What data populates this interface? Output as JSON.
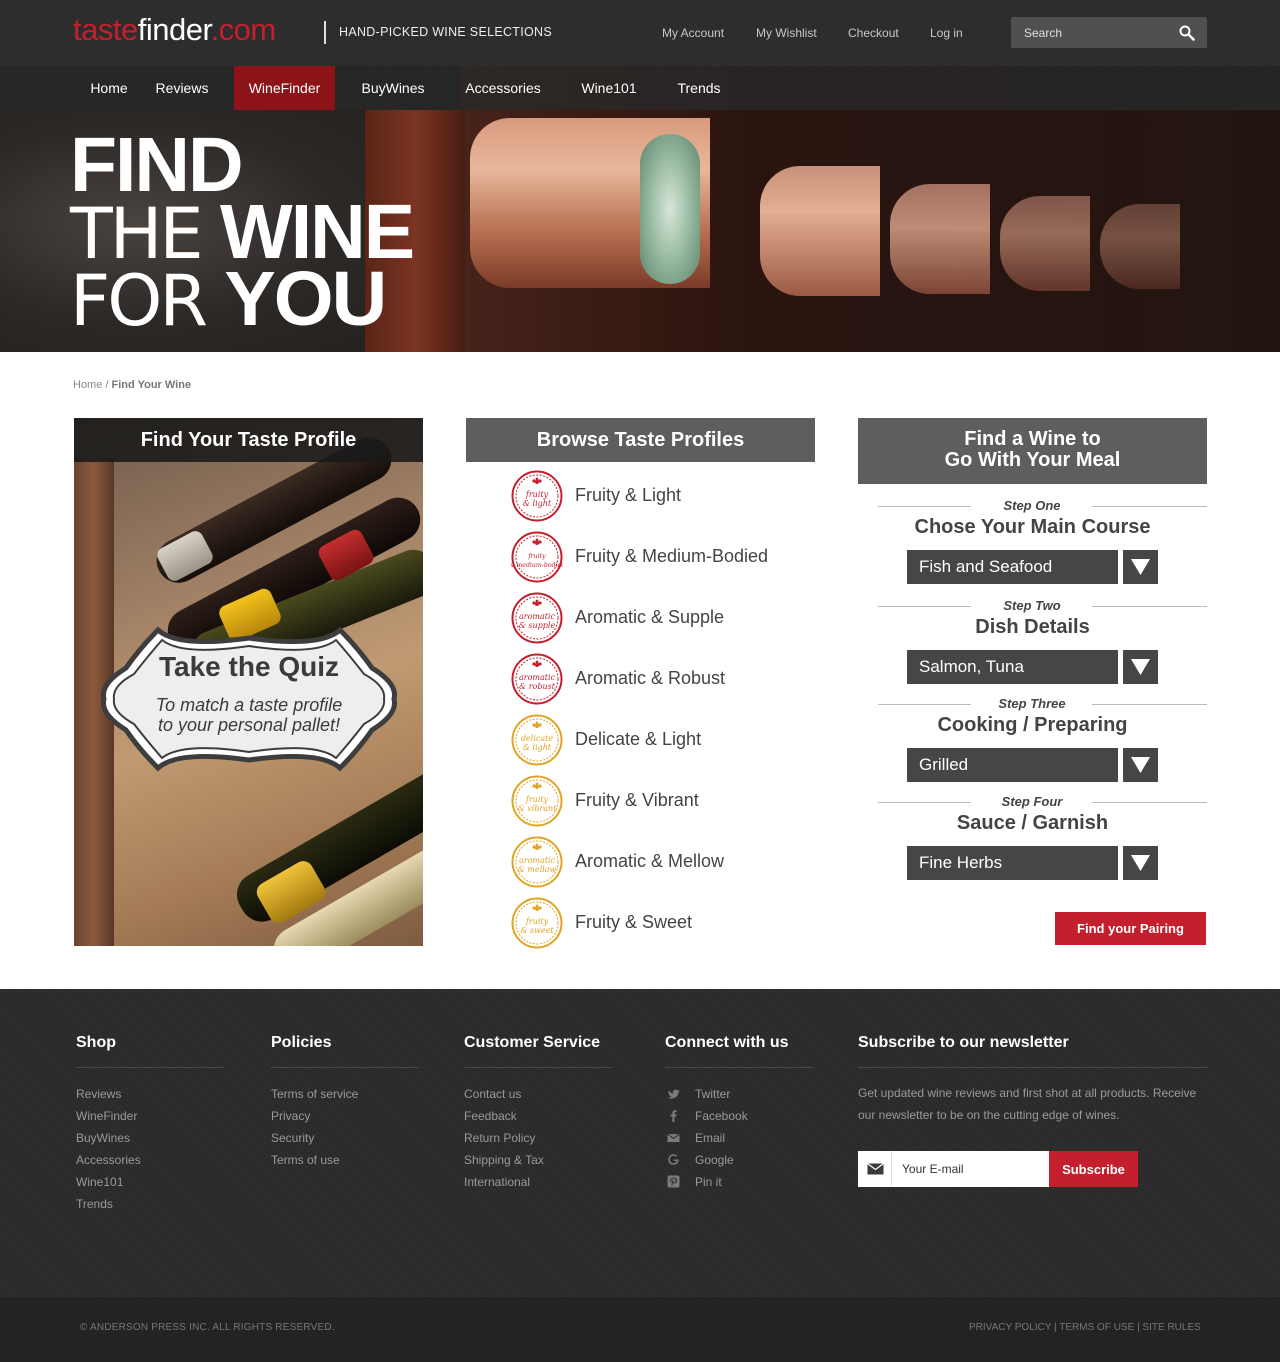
{
  "header": {
    "logo": {
      "part1": "taste",
      "part2": "finder",
      "part3": ".com"
    },
    "tagline": "HAND-PICKED WINE SELECTIONS",
    "links": [
      "My Account",
      "My Wishlist",
      "Checkout",
      "Log in"
    ],
    "search_placeholder": "Search"
  },
  "nav": {
    "items": [
      "Home",
      "Reviews",
      "WineFinder",
      "BuyWines",
      "Accessories",
      "Wine101",
      "Trends"
    ],
    "active": "WineFinder"
  },
  "hero": {
    "line1": "FIND",
    "line2_thin": "THE",
    "line2_bold": "WINE",
    "line3_thin": "FOR",
    "line3_bold": "YOU"
  },
  "breadcrumb": {
    "home": "Home",
    "separator": "/",
    "current": "Find Your Wine"
  },
  "quiz": {
    "heading": "Find Your Taste Profile",
    "title": "Take the Quiz",
    "subtitle_line1": "To match a taste profile",
    "subtitle_line2": "to your personal pallet!"
  },
  "browse": {
    "heading": "Browse Taste Profiles",
    "profiles": [
      {
        "name": "Fruity & Light",
        "seal_text": "fruity & light",
        "color": "#c41f2c"
      },
      {
        "name": "Fruity & Medium-Bodied",
        "seal_text": "fruity & medium-bodied",
        "color": "#c41f2c"
      },
      {
        "name": "Aromatic & Supple",
        "seal_text": "aromatic & supple",
        "color": "#c41f2c"
      },
      {
        "name": "Aromatic & Robust",
        "seal_text": "aromatic & robust",
        "color": "#c41f2c"
      },
      {
        "name": "Delicate & Light",
        "seal_text": "delicate & light",
        "color": "#e0a524"
      },
      {
        "name": "Fruity & Vibrant",
        "seal_text": "fruity & vibrant",
        "color": "#e0a524"
      },
      {
        "name": "Aromatic & Mellow",
        "seal_text": "aromatic & mellow",
        "color": "#e0a524"
      },
      {
        "name": "Fruity & Sweet",
        "seal_text": "fruity & sweet",
        "color": "#e0a524"
      }
    ]
  },
  "meal": {
    "heading_line1": "Find a Wine to",
    "heading_line2": "Go With Your Meal",
    "steps": [
      {
        "label": "Step One",
        "title": "Chose Your Main Course",
        "value": "Fish and Seafood"
      },
      {
        "label": "Step Two",
        "title": "Dish Details",
        "value": "Salmon, Tuna"
      },
      {
        "label": "Step Three",
        "title": "Cooking / Preparing",
        "value": "Grilled"
      },
      {
        "label": "Step Four",
        "title": "Sauce / Garnish",
        "value": "Fine Herbs"
      }
    ],
    "button": "Find your Pairing"
  },
  "footer": {
    "shop": {
      "title": "Shop",
      "links": [
        "Reviews",
        "WineFinder",
        "BuyWines",
        "Accessories",
        "Wine101",
        "Trends"
      ]
    },
    "policies": {
      "title": "Policies",
      "links": [
        "Terms of service",
        "Privacy",
        "Security",
        "Terms of use"
      ]
    },
    "customer_service": {
      "title": "Customer Service",
      "links": [
        "Contact us",
        "Feedback",
        "Return Policy",
        "Shipping & Tax",
        "International"
      ]
    },
    "connect": {
      "title": "Connect with us",
      "links": [
        {
          "label": "Twitter",
          "icon": "twitter-icon"
        },
        {
          "label": "Facebook",
          "icon": "facebook-icon"
        },
        {
          "label": "Email",
          "icon": "email-icon"
        },
        {
          "label": "Google",
          "icon": "google-icon"
        },
        {
          "label": "Pin it",
          "icon": "pinterest-icon"
        }
      ]
    },
    "newsletter": {
      "title": "Subscribe to our newsletter",
      "text": "Get updated wine reviews and first shot at all products. Receive our newsletter to be on the cutting edge of wines.",
      "placeholder": "Your E-mail",
      "button": "Subscribe"
    },
    "copyright": "© ANDERSON PRESS INC.   ALL RIGHTS RESERVED.",
    "legal_links": [
      "PRIVACY POLICY",
      "TERMS OF USE",
      "SITE RULES"
    ],
    "legal_separator": "|"
  },
  "colors": {
    "brand_red": "#c41f2c",
    "nav_active": "#8c1419",
    "gold": "#e0a524",
    "dark": "#2b2b2b"
  }
}
